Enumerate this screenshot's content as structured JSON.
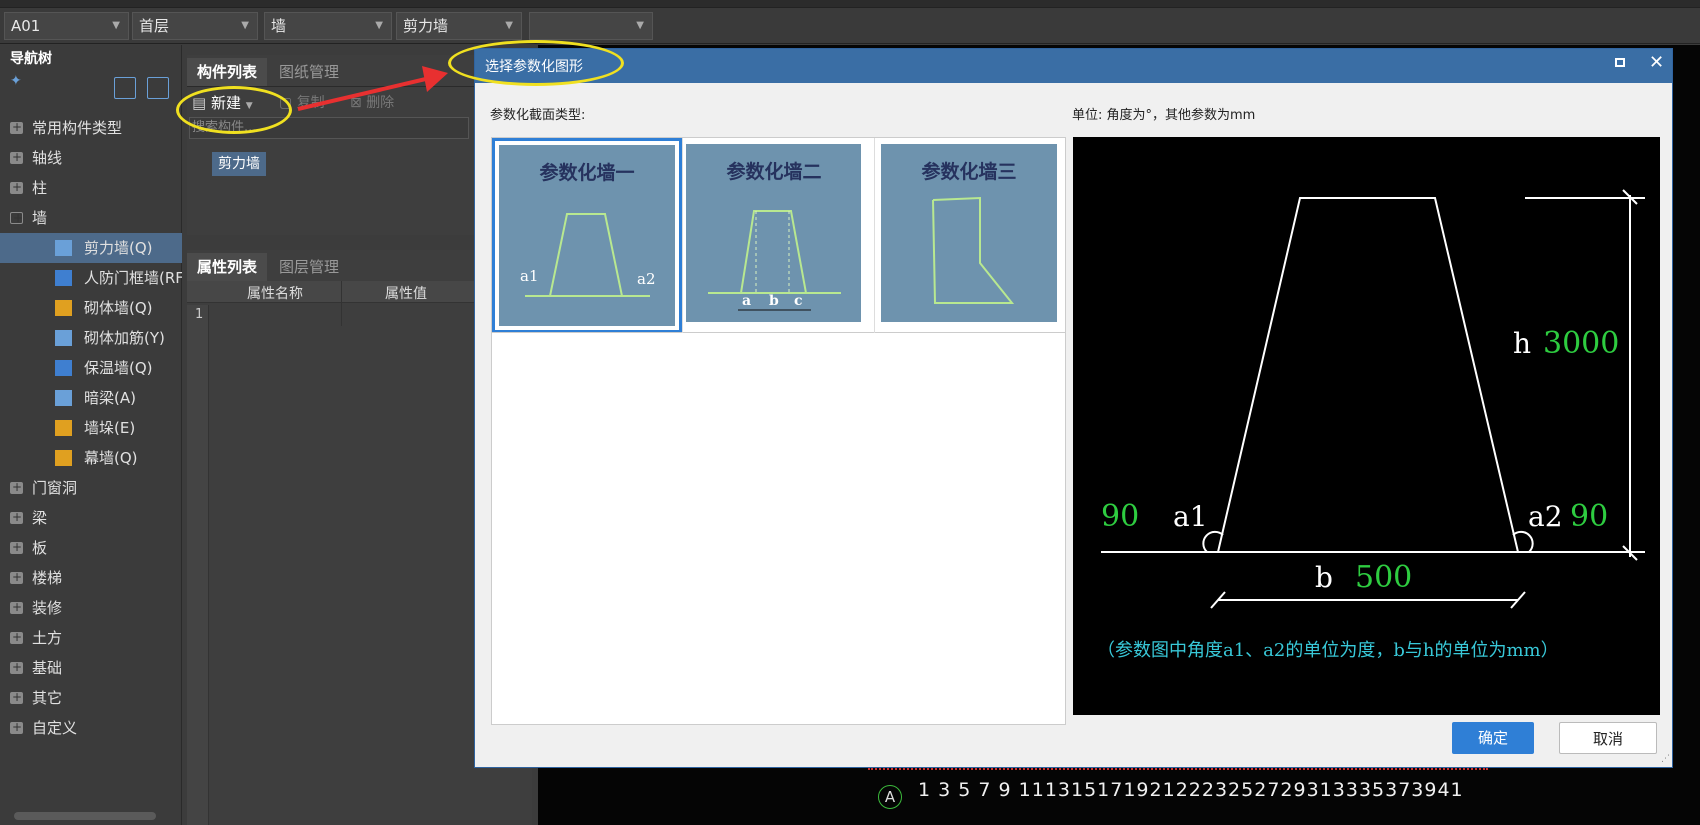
{
  "toolbar": {
    "combos": [
      "A01",
      "首层",
      "墙",
      "剪力墙",
      ""
    ]
  },
  "nav": {
    "title": "导航树",
    "categories_top": [
      "常用构件类型",
      "轴线",
      "柱",
      "墙"
    ],
    "wall_items": [
      {
        "label": "剪力墙(Q)",
        "icon": "shear-wall-icon",
        "color": "#6aa0d8"
      },
      {
        "label": "人防门框墙(RF",
        "icon": "civil-defense-wall-icon",
        "color": "#3f7fd0"
      },
      {
        "label": "砌体墙(Q)",
        "icon": "masonry-wall-icon",
        "color": "#e0a020"
      },
      {
        "label": "砌体加筋(Y)",
        "icon": "masonry-rebar-icon",
        "color": "#6aa0d8"
      },
      {
        "label": "保温墙(Q)",
        "icon": "insulation-wall-icon",
        "color": "#3f7fd0"
      },
      {
        "label": "暗梁(A)",
        "icon": "hidden-beam-icon",
        "color": "#6aa0d8"
      },
      {
        "label": "墙垛(E)",
        "icon": "wall-pier-icon",
        "color": "#e0a020"
      },
      {
        "label": "幕墙(Q)",
        "icon": "curtain-wall-icon",
        "color": "#e0a020"
      }
    ],
    "categories_bottom": [
      "门窗洞",
      "梁",
      "板",
      "楼梯",
      "装修",
      "土方",
      "基础",
      "其它",
      "自定义"
    ]
  },
  "comp_panel": {
    "tab_active": "构件列表",
    "tab_other": "图纸管理",
    "new_label": "新建",
    "copy_label": "复制",
    "delete_label": "删除",
    "search_placeholder": "搜索构件...",
    "item": "剪力墙"
  },
  "props_panel": {
    "tab_active": "属性列表",
    "tab_other": "图层管理",
    "col_name": "属性名称",
    "col_value": "属性值",
    "row_index": "1"
  },
  "dialog": {
    "title": "选择参数化图形",
    "section_label": "参数化截面类型:",
    "unit_label": "单位: 角度为°，其他参数为mm",
    "shapes": [
      "参数化墙一",
      "参数化墙二",
      "参数化墙三"
    ],
    "thumb_labels": {
      "a1": "a1",
      "a2": "a2",
      "a": "a",
      "b": "b",
      "c": "c"
    },
    "preview": {
      "h_label": "h",
      "h_value": "3000",
      "a1_label": "a1",
      "a1_value": "90",
      "a2_label": "a2",
      "a2_value": "90",
      "b_label": "b",
      "b_value": "500",
      "note": "（参数图中角度a1、a2的单位为度，b与h的单位为mm）"
    },
    "ok_label": "确定",
    "cancel_label": "取消"
  },
  "canvas": {
    "axis_label": "A",
    "axis_numbers": "1 3 5 7 9 1113151719212223252729313335373941"
  },
  "colors": {
    "dialog_header": "#3a6ea5",
    "highlight": "#f0e020",
    "arrow": "#e83030",
    "preview_value": "#2ecc40",
    "preview_note": "#38c8d8",
    "ok_button": "#2f7fd6"
  }
}
